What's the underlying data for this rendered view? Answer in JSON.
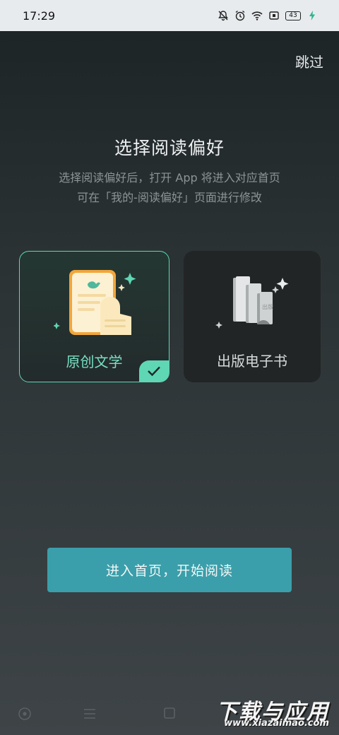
{
  "status_bar": {
    "time": "17:29",
    "battery_level": "43",
    "icons": [
      "mute-bell-icon",
      "alarm-icon",
      "wifi-icon",
      "nfc-icon",
      "battery-icon",
      "charging-icon"
    ]
  },
  "header": {
    "skip_label": "跳过"
  },
  "main": {
    "title": "选择阅读偏好",
    "subtitle_line1": "选择阅读偏好后，打开 App 将进入对应首页",
    "subtitle_line2": "可在「我的-阅读偏好」页面进行修改",
    "options": [
      {
        "label": "原创文学",
        "selected": true,
        "icon": "original-literature-icon"
      },
      {
        "label": "出版电子书",
        "selected": false,
        "icon": "published-ebook-icon"
      }
    ],
    "cta_label": "进入首页，开始阅读"
  },
  "colors": {
    "accent": "#5fd6b4",
    "cta": "#3a9faa",
    "card_unselected": "#222526"
  },
  "nav_bar": {
    "icons": [
      "home-circle-icon",
      "menu-lines-icon",
      "square-icon"
    ]
  },
  "watermark": {
    "title": "下载与应用",
    "url": "www.xiazaimao.com"
  }
}
